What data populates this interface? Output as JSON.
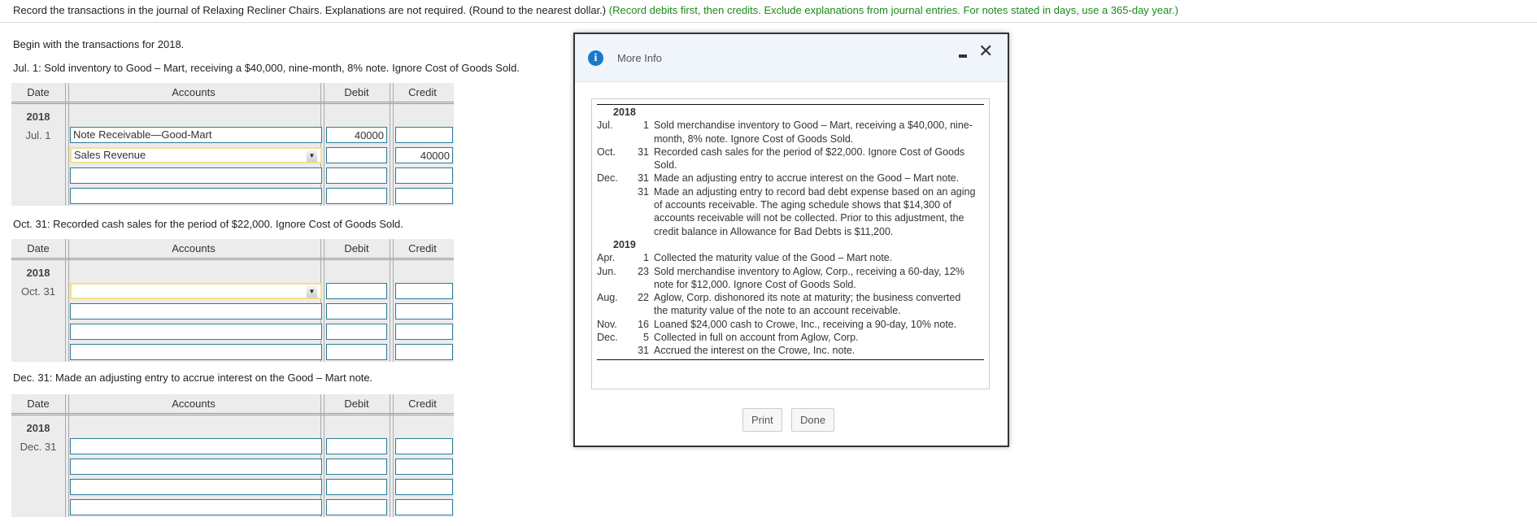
{
  "instructions": {
    "main": "Record the transactions in the journal of Relaxing Recliner Chairs. Explanations are not required. (Round to the nearest dollar.)",
    "hint": "(Record debits first, then credits. Exclude explanations from journal entries. For notes stated in days, use a 365-day year.)"
  },
  "intro": "Begin with the transactions for 2018.",
  "columns": {
    "date": "Date",
    "accounts": "Accounts",
    "debit": "Debit",
    "credit": "Credit"
  },
  "entries": [
    {
      "prompt": "Jul. 1: Sold inventory to Good – Mart, receiving a $40,000, nine-month, 8% note. Ignore Cost of Goods Sold.",
      "year": "2018",
      "date": "Jul. 1",
      "rows": [
        {
          "account": "Note Receivable—Good-Mart",
          "debit": "40000",
          "credit": "",
          "dropdown": false
        },
        {
          "account": "Sales Revenue",
          "debit": "",
          "credit": "40000",
          "dropdown": true
        },
        {
          "account": "",
          "debit": "",
          "credit": "",
          "dropdown": false
        },
        {
          "account": "",
          "debit": "",
          "credit": "",
          "dropdown": false
        }
      ]
    },
    {
      "prompt": "Oct. 31: Recorded cash sales for the period of $22,000. Ignore Cost of Goods Sold.",
      "year": "2018",
      "date": "Oct. 31",
      "rows": [
        {
          "account": "",
          "debit": "",
          "credit": "",
          "dropdown": true
        },
        {
          "account": "",
          "debit": "",
          "credit": "",
          "dropdown": false
        },
        {
          "account": "",
          "debit": "",
          "credit": "",
          "dropdown": false
        },
        {
          "account": "",
          "debit": "",
          "credit": "",
          "dropdown": false
        }
      ]
    },
    {
      "prompt": "Dec. 31: Made an adjusting entry to accrue interest on the Good – Mart note.",
      "year": "2018",
      "date": "Dec. 31",
      "rows": [
        {
          "account": "",
          "debit": "",
          "credit": "",
          "dropdown": false
        },
        {
          "account": "",
          "debit": "",
          "credit": "",
          "dropdown": false
        },
        {
          "account": "",
          "debit": "",
          "credit": "",
          "dropdown": false
        },
        {
          "account": "",
          "debit": "",
          "credit": "",
          "dropdown": false
        }
      ]
    }
  ],
  "modal": {
    "title": "More Info",
    "icon": "info-icon",
    "print_label": "Print",
    "done_label": "Done",
    "items": [
      {
        "year": "2018"
      },
      {
        "month": "Jul.",
        "day": "1",
        "text": "Sold merchandise inventory to Good – Mart, receiving a $40,000, nine-month, 8% note. Ignore Cost of Goods Sold."
      },
      {
        "month": "Oct.",
        "day": "31",
        "text": "Recorded cash sales for the period of $22,000. Ignore Cost of Goods Sold."
      },
      {
        "month": "Dec.",
        "day": "31",
        "text": "Made an adjusting entry to accrue interest on the Good – Mart note."
      },
      {
        "month": "",
        "day": "31",
        "text": "Made an adjusting entry to record bad debt expense based on an aging of accounts receivable. The aging schedule shows that $14,300 of accounts receivable will not be collected. Prior to this adjustment, the credit balance in Allowance for Bad Debts is $11,200."
      },
      {
        "year": "2019"
      },
      {
        "month": "Apr.",
        "day": "1",
        "text": "Collected the maturity value of the Good – Mart note."
      },
      {
        "month": "Jun.",
        "day": "23",
        "text": "Sold merchandise inventory to Aglow, Corp., receiving a 60-day, 12% note for $12,000. Ignore Cost of Goods Sold."
      },
      {
        "month": "Aug.",
        "day": "22",
        "text": "Aglow, Corp. dishonored its note at maturity; the business converted the maturity value of the note to an account receivable."
      },
      {
        "month": "Nov.",
        "day": "16",
        "text": "Loaned $24,000 cash to Crowe, Inc., receiving a 90-day, 10% note."
      },
      {
        "month": "Dec.",
        "day": "5",
        "text": "Collected in full on account from Aglow, Corp."
      },
      {
        "month": "",
        "day": "31",
        "text": "Accrued the interest on the Crowe, Inc. note."
      }
    ]
  },
  "colors": {
    "hint": "#1a8a1a",
    "input_border": "#2d7a9a",
    "focus_border": "#f3df8e",
    "info_icon": "#1a78c8"
  }
}
